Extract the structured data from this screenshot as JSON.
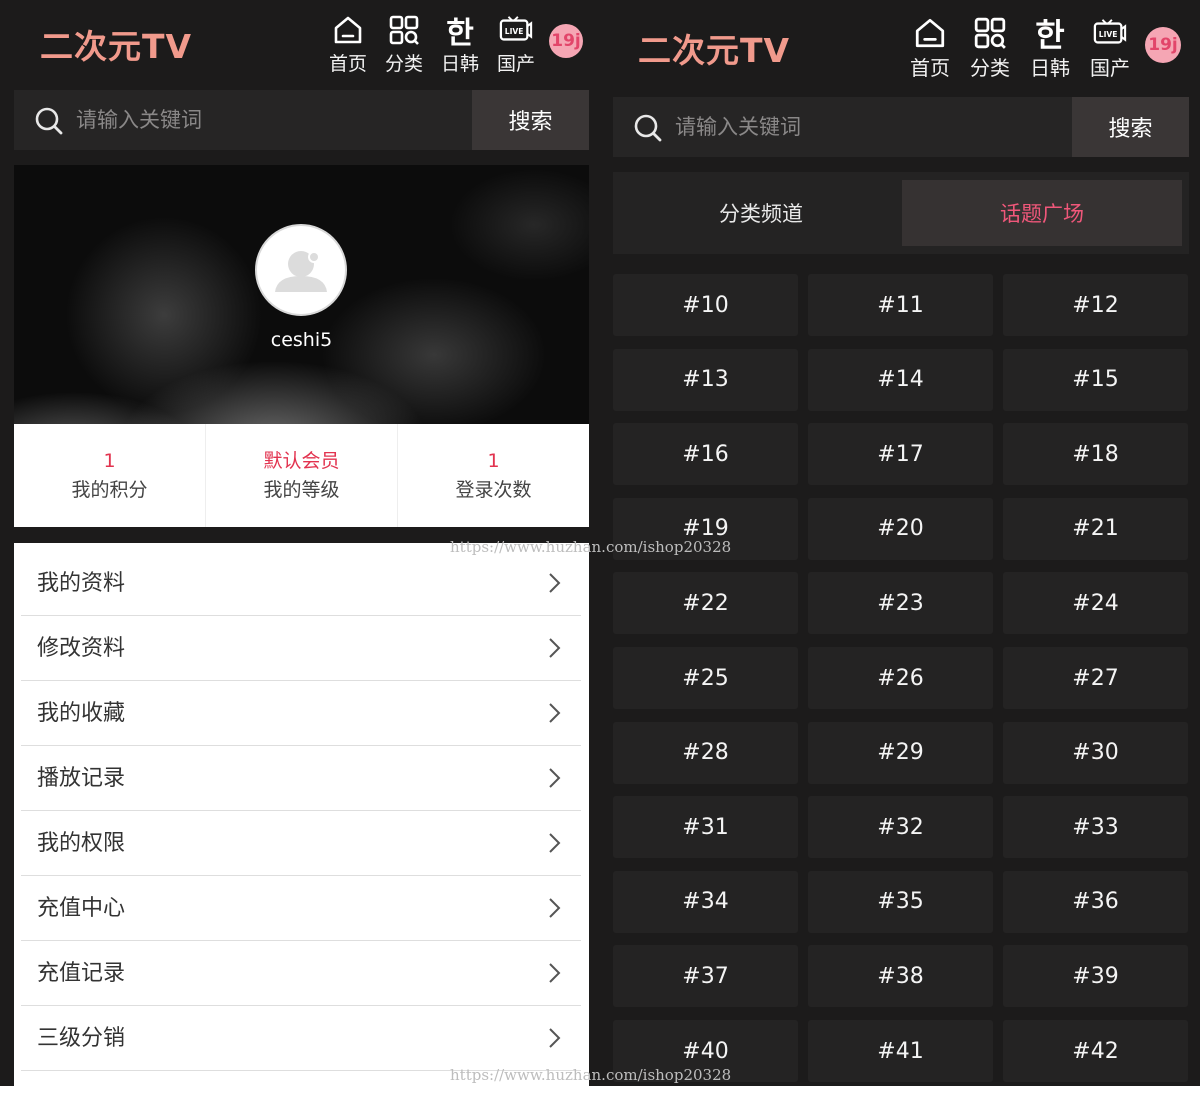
{
  "app": {
    "logo_text": "二次元TV"
  },
  "nav": [
    {
      "label": "首页",
      "icon": "home-icon"
    },
    {
      "label": "分类",
      "icon": "category-grid-icon"
    },
    {
      "label": "日韩",
      "icon": "korean-han-icon",
      "glyph": "한"
    },
    {
      "label": "国产",
      "icon": "live-tv-icon",
      "glyph": "LIVE"
    }
  ],
  "badge": {
    "text": "19j",
    "icon": "adult-19-badge-icon"
  },
  "search": {
    "placeholder": "请输入关键词",
    "button_label": "搜索"
  },
  "profile": {
    "username": "ceshi5",
    "stats": [
      {
        "value": "1",
        "label": "我的积分"
      },
      {
        "value": "默认会员",
        "label": "我的等级"
      },
      {
        "value": "1",
        "label": "登录次数"
      }
    ]
  },
  "menu": [
    "我的资料",
    "修改资料",
    "我的收藏",
    "播放记录",
    "我的权限",
    "充值中心",
    "充值记录",
    "三级分销"
  ],
  "tabs": [
    {
      "label": "分类频道",
      "active": false
    },
    {
      "label": "话题广场",
      "active": true
    }
  ],
  "tags": [
    "#10",
    "#11",
    "#12",
    "#13",
    "#14",
    "#15",
    "#16",
    "#17",
    "#18",
    "#19",
    "#20",
    "#21",
    "#22",
    "#23",
    "#24",
    "#25",
    "#26",
    "#27",
    "#28",
    "#29",
    "#30",
    "#31",
    "#32",
    "#33",
    "#34",
    "#35",
    "#36",
    "#37",
    "#38",
    "#39",
    "#40",
    "#41",
    "#42"
  ],
  "watermark": "https://www.huzhan.com/ishop20328",
  "colors": {
    "background": "#1c1b1b",
    "logo": "#f19a8c",
    "accent_pink": "#f0577a",
    "stat_red": "#e2334f"
  }
}
